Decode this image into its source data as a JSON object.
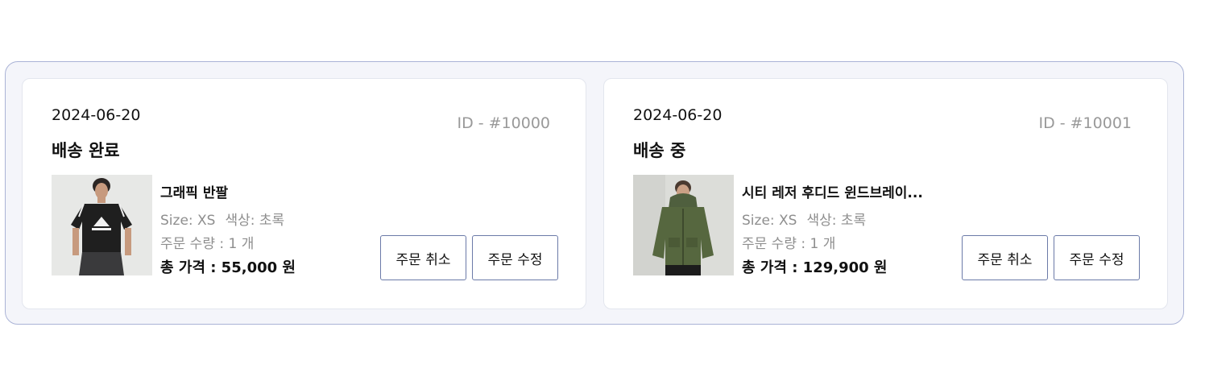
{
  "orders": [
    {
      "date": "2024-06-20",
      "status": "배송 완료",
      "order_id": "ID - #10000",
      "product_name": "그래픽 반팔",
      "size": "Size: XS",
      "color": "색상: 초록",
      "quantity": "주문 수량 : 1 개",
      "total_price": "총 가격 : 55,000 원",
      "cancel_label": "주문 취소",
      "edit_label": "주문 수정",
      "image_subject": "black-graphic-tshirt-model"
    },
    {
      "date": "2024-06-20",
      "status": "배송 중",
      "order_id": "ID - #10001",
      "product_name": "시티 레저 후디드 윈드브레이...",
      "size": "Size: XS",
      "color": "색상: 초록",
      "quantity": "주문 수량 : 1 개",
      "total_price": "총 가격 : 129,900 원",
      "cancel_label": "주문 취소",
      "edit_label": "주문 수정",
      "image_subject": "green-hooded-windbreaker-model"
    }
  ],
  "colors": {
    "panel_border": "#aab3d6",
    "panel_bg": "#f4f5fa",
    "button_border": "#6b7aa8",
    "muted_text": "#8e8e8e"
  }
}
